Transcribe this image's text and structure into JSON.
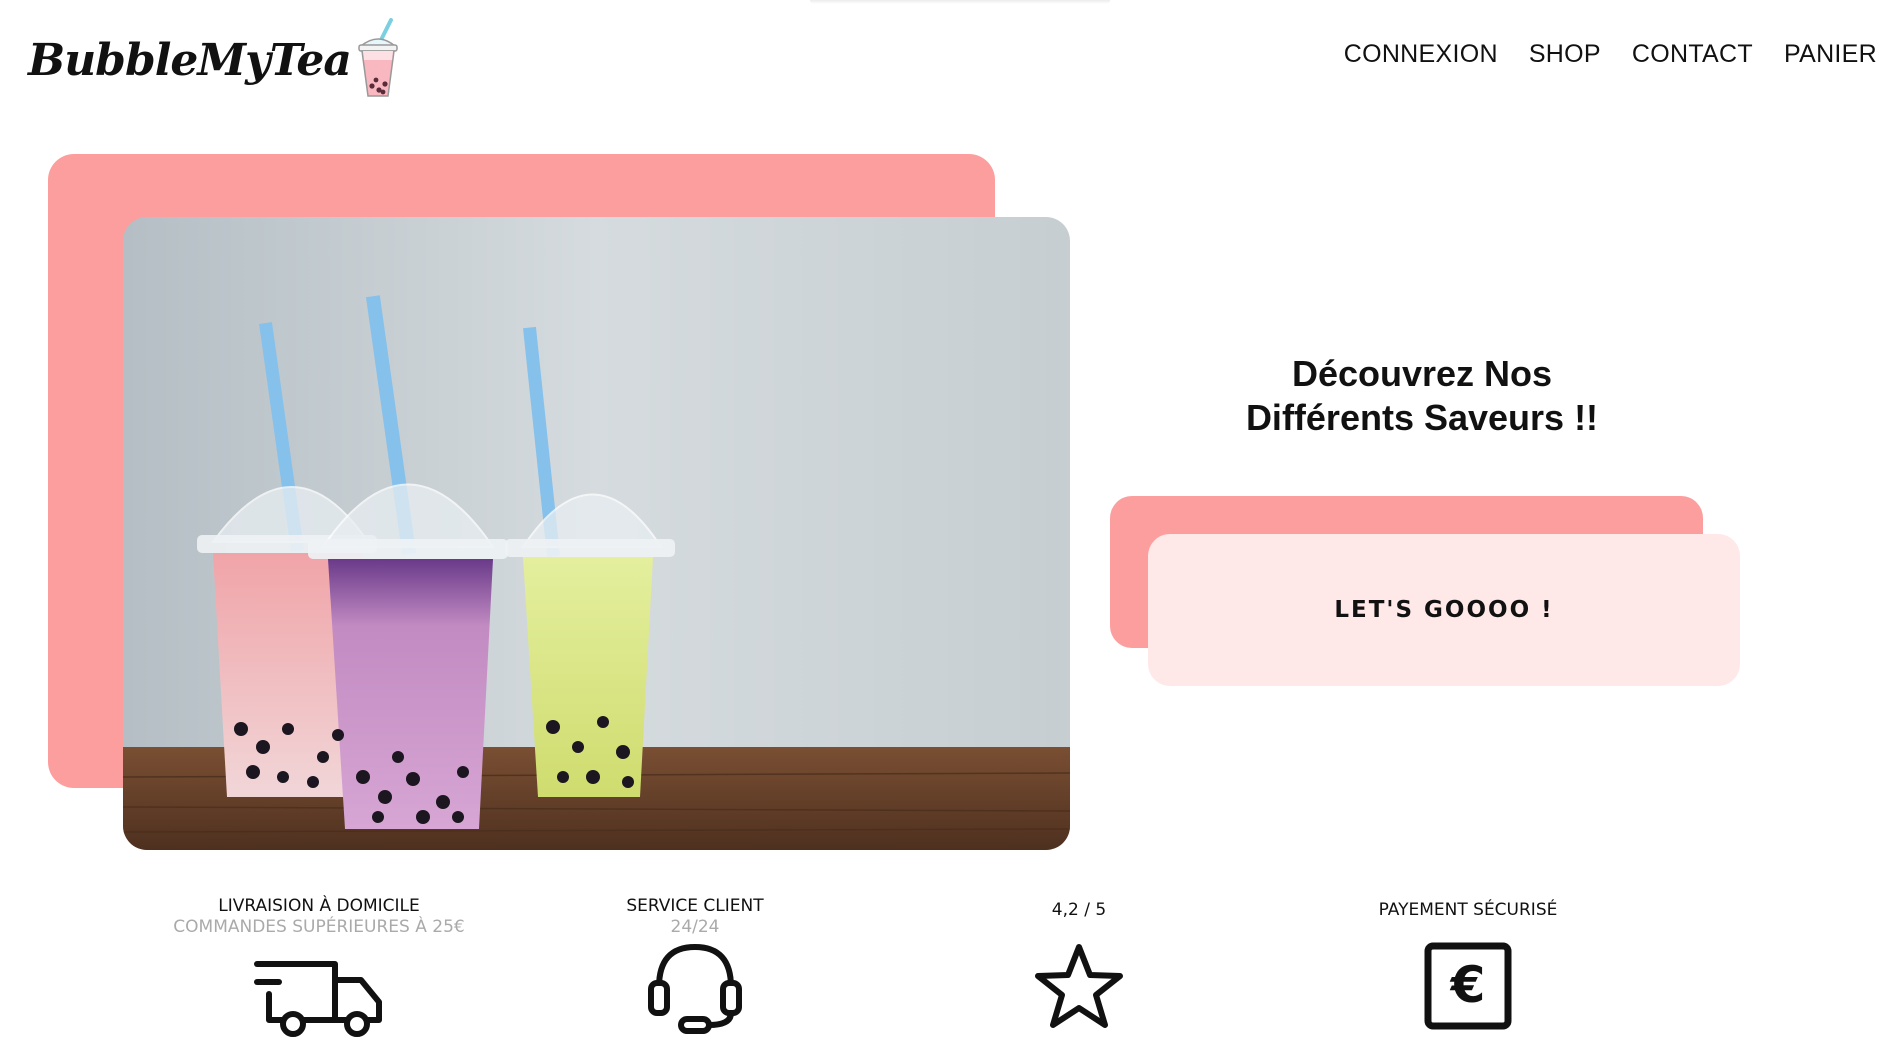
{
  "header": {
    "logo_text": "BubbleMyTea",
    "nav": [
      {
        "label": "CONNEXION"
      },
      {
        "label": "SHOP"
      },
      {
        "label": "CONTACT"
      },
      {
        "label": "PANIER"
      }
    ]
  },
  "hero": {
    "headline_line1": "Découvrez Nos",
    "headline_line2": "Différents Saveurs !!",
    "cta_label": "LET'S GOOOO !"
  },
  "features": [
    {
      "title": "LIVRAISION À DOMICILE",
      "subtitle": "COMMANDES SUPÉRIEURES À 25€",
      "icon": "truck-icon"
    },
    {
      "title": "SERVICE CLIENT",
      "subtitle": "24/24",
      "icon": "headset-icon"
    },
    {
      "title": "4,2 / 5",
      "subtitle": "",
      "icon": "star-icon"
    },
    {
      "title": "PAYEMENT SÉCURISÉ",
      "subtitle": "",
      "icon": "euro-icon"
    }
  ],
  "colors": {
    "accent_pink": "#fd9e9e",
    "light_pink": "#ffe8e8",
    "text": "#111111"
  }
}
